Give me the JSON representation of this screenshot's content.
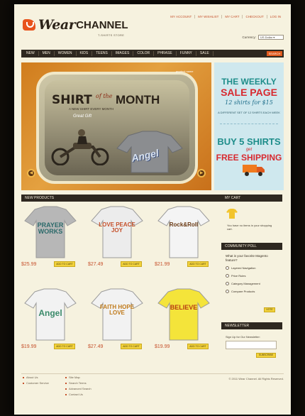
{
  "header": {
    "logo_word1": "Wear",
    "logo_word2": "CHANNEL",
    "tagline": "T-SHIRTS STORE",
    "top_links": [
      "MY ACCOUNT",
      "MY WISHLIST",
      "MY CART",
      "CHECKOUT",
      "LOG IN"
    ],
    "currency_label": "Currency:",
    "currency_value": "US Dollar"
  },
  "nav": {
    "items": [
      "NEW",
      "MEN",
      "WOMEN",
      "KIDS",
      "TEENS",
      "IMAGES",
      "COLOR",
      "PHRASE",
      "FUNNY",
      "SALE"
    ],
    "search_label": "SEARCH"
  },
  "hero": {
    "title_a": "SHIRT",
    "title_of": "of the",
    "title_b": "MONTH",
    "subtitle": "A NEW SHIRT EVERY MONTH",
    "great": "Great Gift",
    "shirt_text": "Angel",
    "label": "product name"
  },
  "sale": {
    "line1": "THE WEEKLY",
    "line2": "SALE PAGE",
    "line3": "12 shirts for $15",
    "line4": "A DIFFERENT SET OF 12 SHIRTS EACH WEEK",
    "buy": "BUY 5 SHIRTS",
    "get": "get",
    "free": "FREE SHIPPING"
  },
  "products": {
    "heading": "NEW PRODUCTS",
    "add_label": "ADD TO CART",
    "items": [
      {
        "price": "$25.99",
        "text": "PRAYER WORKS",
        "shirt": "#b7b7b7"
      },
      {
        "price": "$27.49",
        "text": "LOVE PEACE JOY",
        "shirt": "#ececec"
      },
      {
        "price": "$21.99",
        "text": "Rock&Roll",
        "shirt": "#f4f4f4"
      },
      {
        "price": "$19.99",
        "text": "Angel",
        "shirt": "#f2f2f2"
      },
      {
        "price": "$27.49",
        "text": "FAITH HOPE LOVE",
        "shirt": "#f2f2f2"
      },
      {
        "price": "$19.99",
        "text": "BELIEVE",
        "shirt": "#f4e43a"
      }
    ]
  },
  "cart": {
    "heading": "MY CART",
    "empty": "You have no items in your shopping cart."
  },
  "poll": {
    "heading": "COMMUNITY POLL",
    "question": "What is your favorite Magento feature?",
    "options": [
      "Layered Navigation",
      "Price Rules",
      "Category Management",
      "Compare Products"
    ],
    "vote": "VOTE"
  },
  "newsletter": {
    "heading": "NEWSLETTER",
    "label": "Sign Up for Our Newsletter:",
    "subscribe": "SUBSCRIBE"
  },
  "footer": {
    "col1": [
      "About Us",
      "Customer Service"
    ],
    "col2": [
      "Site Map",
      "Search Terms",
      "Advanced Search",
      "Contact Us"
    ],
    "copyright": "© 2011 Wear Channel. All Rights Reserved."
  },
  "colors": {
    "accent": "#e05a1e",
    "nav_bg": "#2e2820",
    "price": "#c6512c",
    "button": "#f2d23c"
  }
}
